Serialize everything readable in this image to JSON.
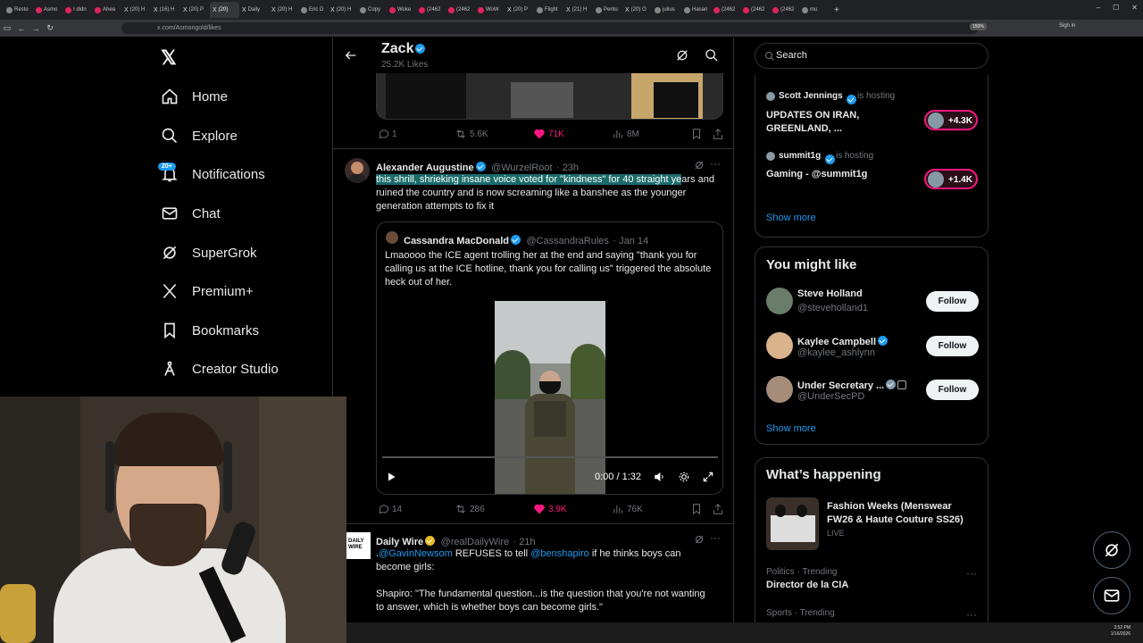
{
  "browser": {
    "tabs": [
      "Resto",
      "Asmo",
      "I didn",
      "Ahea",
      "(20) H",
      "(16) H",
      "(20) P",
      "(20) ",
      "Daily",
      "(20) H",
      "Eric D",
      "(20) H",
      "Copy",
      "Woke",
      "(2462",
      "(2462",
      "WoW",
      "(20) P",
      "Flight",
      "(21) H",
      "Pentu",
      "(20) O",
      "julius",
      "Hasan",
      "(2462",
      "(2462",
      "(2462",
      "mu"
    ],
    "url": "x.com/Asmongold/likes",
    "zoom": "150%",
    "sign_in": "Sign in"
  },
  "nav": {
    "items": [
      {
        "label": "Home",
        "icon": "home-icon"
      },
      {
        "label": "Explore",
        "icon": "search-icon"
      },
      {
        "label": "Notifications",
        "icon": "bell-icon"
      },
      {
        "label": "Chat",
        "icon": "mail-icon"
      },
      {
        "label": "SuperGrok",
        "icon": "grok-icon"
      },
      {
        "label": "Premium+",
        "icon": "x-premium-icon"
      },
      {
        "label": "Bookmarks",
        "icon": "bookmark-icon"
      },
      {
        "label": "Creator Studio",
        "icon": "creator-studio-icon"
      }
    ],
    "notifications_badge": "20+"
  },
  "profile_header": {
    "name": "Zack",
    "likes": "25.2K Likes"
  },
  "feed": {
    "top_actions": {
      "replies": "1",
      "reposts": "5.6K",
      "likes": "71K",
      "views": "8M"
    },
    "tweet1": {
      "name": "Alexander Augustine",
      "handle": "@WurzelRoot",
      "time": "· 23h",
      "text_highlight": "this shrill, shrieking insane voice voted for \"kindness\" for 40 straight ye",
      "text_rest": "ars and ruined the country and is now screaming like a banshee as the younger generation attempts to fix it",
      "quote": {
        "name": "Cassandra MacDonald",
        "handle": "@CassandraRules",
        "time": "· Jan 14",
        "text": "Lmaoooo the ICE agent trolling her at the end and saying \"thank you for calling us at the ICE hotline, thank you for calling us\" triggered the absolute heck out of her."
      },
      "video": {
        "time": "0:00 / 1:32",
        "progress": 0
      },
      "actions": {
        "replies": "14",
        "reposts": "286",
        "likes": "3.9K",
        "views": "76K"
      }
    },
    "tweet2": {
      "name": "Daily Wire",
      "handle": "@realDailyWire",
      "time": "· 21h",
      "avatar_text": "DAILY WIRE",
      "mention1": "@GavinNewsom",
      "text_mid": " REFUSES to tell ",
      "mention2": "@benshapiro",
      "text_end": " if he thinks boys can become girls:",
      "quote_text": "Shapiro: \"The fundamental question...is the question that you're not wanting to answer, which is whether boys can become girls.\""
    }
  },
  "right": {
    "search_placeholder": "Search",
    "spaces": [
      {
        "host": "Scott Jennings",
        "status": "is hosting",
        "title": "UPDATES ON IRAN, GREENLAND, ...",
        "count": "+4.3K"
      },
      {
        "host": "summit1g",
        "status": "is hosting",
        "title": "Gaming - @summit1g",
        "count": "+1.4K"
      }
    ],
    "show_more": "Show more",
    "you_might_like": {
      "title": "You might like",
      "users": [
        {
          "name": "Steve Holland",
          "handle": "@steveholland1"
        },
        {
          "name": "Kaylee Campbell",
          "handle": "@kaylee_ashlynn"
        },
        {
          "name": "Under Secretary ...",
          "handle": "@UnderSecPD"
        }
      ],
      "follow_label": "Follow",
      "show_more": "Show more"
    },
    "whats_happening": {
      "title": "What’s happening",
      "items": [
        {
          "title": "Fashion Weeks (Menswear FW26 & Haute Couture SS26)",
          "meta": "LIVE"
        },
        {
          "meta": "Politics · Trending",
          "title": "Director de la CIA"
        },
        {
          "meta": "Sports · Trending",
          "title": ""
        }
      ]
    }
  },
  "taskbar": {
    "time": "3:52 PM",
    "date": "1/16/2026"
  },
  "colors": {
    "accent": "#1d9bf0",
    "like": "#f91880",
    "bg": "#000000",
    "border": "#2f3336"
  }
}
